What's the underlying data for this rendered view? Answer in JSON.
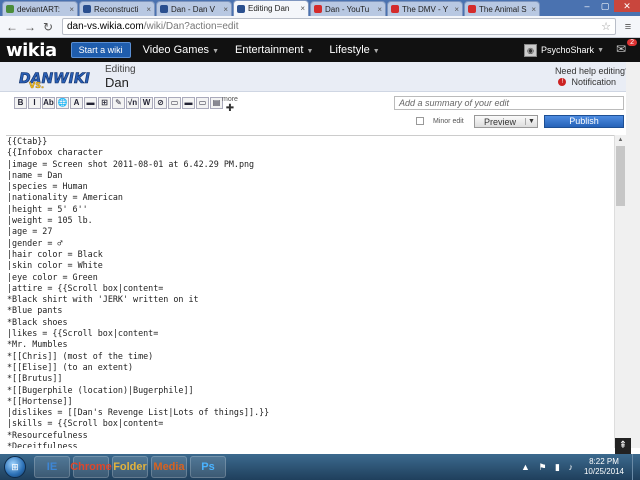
{
  "browser": {
    "tabs": [
      {
        "label": "deviantART:",
        "favicon_color": "#4b8d3a",
        "active": false
      },
      {
        "label": "Reconstructi",
        "favicon_color": "#2a4f8f",
        "active": false
      },
      {
        "label": "Dan - Dan V",
        "favicon_color": "#2a4f8f",
        "active": false
      },
      {
        "label": "Editing Dan",
        "favicon_color": "#2a4f8f",
        "active": true
      },
      {
        "label": "Dan - YouTu",
        "favicon_color": "#d42b2b",
        "active": false
      },
      {
        "label": "The DMV - Y",
        "favicon_color": "#d42b2b",
        "active": false
      },
      {
        "label": "The Animal S",
        "favicon_color": "#d42b2b",
        "active": false
      }
    ],
    "url_host": "dan-vs.wikia.com",
    "url_path": "/wiki/Dan?action=edit"
  },
  "wikia_nav": {
    "logo": "wikia",
    "start_wiki": "Start a wiki",
    "items": [
      "Video Games",
      "Entertainment",
      "Lifestyle"
    ],
    "username": "PsychoShark",
    "notif_count": "2"
  },
  "edit_header": {
    "editing_label": "Editing",
    "page_name": "Dan",
    "help": "Need help editing?",
    "notification": "Notification",
    "wiki_logo": "DANWIKI"
  },
  "toolbar": {
    "buttons": [
      "B",
      "I",
      "Ab",
      "🌐",
      "A",
      "▬",
      "⊞",
      "✎",
      "√n",
      "W",
      "⊘",
      "▭",
      "▬",
      "▭",
      "▤"
    ],
    "more": "more",
    "summary_placeholder": "Add a summary of your edit",
    "minor_edit": "Minor edit",
    "preview": "Preview",
    "publish": "Publish"
  },
  "editor": {
    "lines": [
      "{{Ctab}}",
      "{{Infobox character",
      "|image = Screen shot 2011-08-01 at 6.42.29 PM.png",
      "|name = Dan",
      "|species = Human",
      "|nationality = American",
      "|height = 5' 6''",
      "|weight = 105 lb.",
      "|age = 27",
      "|gender = ♂",
      "|hair color = Black",
      "|skin color = White",
      "|eye color = Green",
      "|attire = {{Scroll box|content=",
      "*Black shirt with 'JERK' written on it",
      "*Blue pants",
      "*Black shoes",
      "|likes = {{Scroll box|content=",
      "*Mr. Mumbles",
      "*[[Chris]] (most of the time)",
      "*[[Elise]] (to an extent)",
      "*[[Brutus]]",
      "*[[Bugerphile (location)|Bugerphile]]",
      "*[[Hortense]]",
      "|dislikes = [[Dan's Revenge List|Lots of things]].}}",
      "|skills = {{Scroll box|content=",
      "*Resourcefulness",
      "*Deceitfulness"
    ]
  },
  "taskbar": {
    "apps": [
      "IE",
      "Chrome",
      "Folder",
      "Media",
      "Ps"
    ],
    "time": "8:22 PM",
    "date": "10/25/2014"
  }
}
